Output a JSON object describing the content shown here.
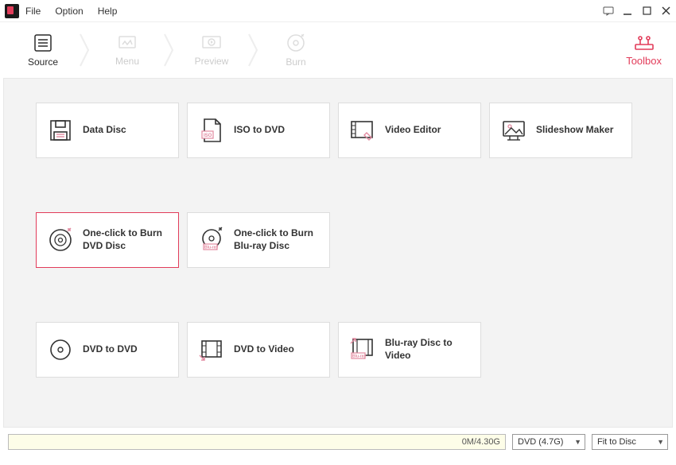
{
  "menu": {
    "file": "File",
    "option": "Option",
    "help": "Help"
  },
  "nav": {
    "source": "Source",
    "menu": "Menu",
    "preview": "Preview",
    "burn": "Burn",
    "toolbox": "Toolbox"
  },
  "tools": {
    "data_disc": "Data Disc",
    "iso_to_dvd": "ISO to DVD",
    "video_editor": "Video Editor",
    "slideshow_maker": "Slideshow Maker",
    "one_click_dvd": "One-click to Burn DVD Disc",
    "one_click_bluray": "One-click to Burn Blu-ray Disc",
    "dvd_to_dvd": "DVD to DVD",
    "dvd_to_video": "DVD to Video",
    "bluray_to_video": "Blu-ray Disc to Video"
  },
  "bottom": {
    "progress_text": "0M/4.30G",
    "disc_type": "DVD (4.7G)",
    "fit": "Fit to Disc"
  }
}
